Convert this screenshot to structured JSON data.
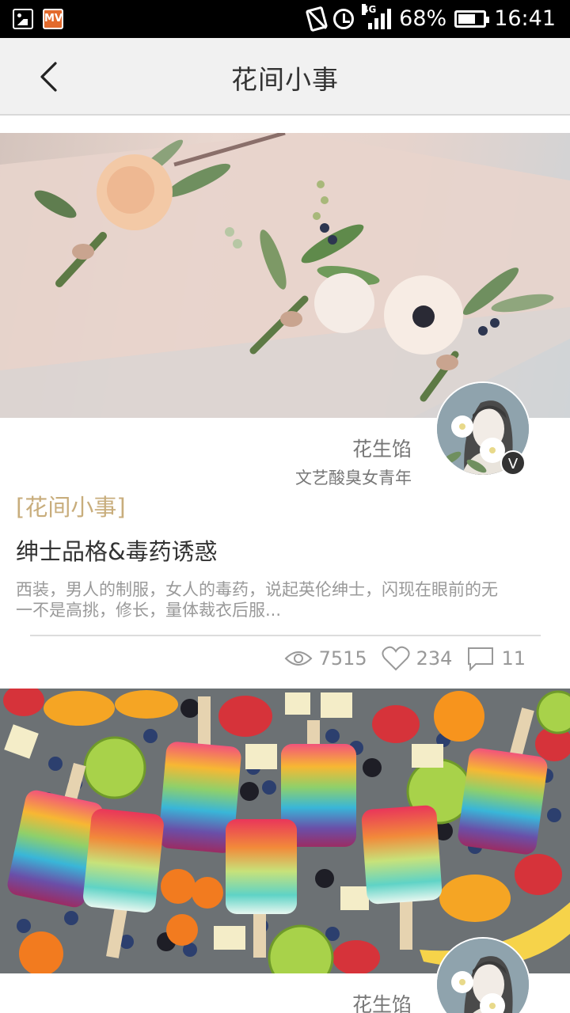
{
  "status_bar": {
    "network": "4G",
    "battery": "68%",
    "battery_level": 0.68,
    "time": "16:41",
    "app_icons": [
      "gallery-icon",
      "mv-app-icon"
    ],
    "mv_label": "MV"
  },
  "header": {
    "title": "花间小事"
  },
  "articles": [
    {
      "author": "花生馅",
      "author_bio": "文艺酸臭女青年",
      "verified_label": "V",
      "category": "[花间小事]",
      "title": "绅士品格&毒药诱惑",
      "summary": "西装，男人的制服，女人的毒药，说起英伦绅士，闪现在眼前的无一不是高挑，修长，量体裁衣后服...",
      "views": "7515",
      "likes": "234",
      "comments": "11"
    },
    {
      "author": "花生馅"
    }
  ],
  "colors": {
    "category": "#c8ad7c",
    "header_bg": "#f1f1f1",
    "status_bar_bg": "#000000"
  }
}
